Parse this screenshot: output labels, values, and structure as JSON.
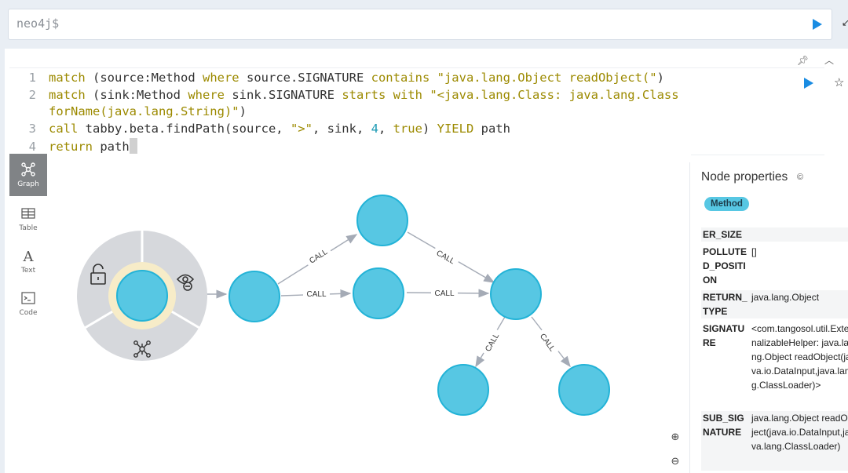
{
  "command_bar": {
    "prompt": "neo4j$"
  },
  "editor": {
    "lines": [
      {
        "n": "1",
        "parts": [
          {
            "c": "kw",
            "t": "match"
          },
          {
            "c": "txt",
            "t": " (source:Method "
          },
          {
            "c": "kw",
            "t": "where"
          },
          {
            "c": "txt",
            "t": " source.SIGNATURE "
          },
          {
            "c": "kw",
            "t": "contains"
          },
          {
            "c": "txt",
            "t": " "
          },
          {
            "c": "str",
            "t": "\"java.lang.Object readObject(\""
          },
          {
            "c": "txt",
            "t": ")"
          }
        ]
      },
      {
        "n": "2",
        "parts": [
          {
            "c": "kw",
            "t": "match"
          },
          {
            "c": "txt",
            "t": " (sink:Method "
          },
          {
            "c": "kw",
            "t": "where"
          },
          {
            "c": "txt",
            "t": " sink.SIGNATURE "
          },
          {
            "c": "kw",
            "t": "starts with"
          },
          {
            "c": "txt",
            "t": " "
          },
          {
            "c": "str",
            "t": "\"<java.lang.Class: java.lang.Class"
          }
        ]
      },
      {
        "n": "",
        "parts": [
          {
            "c": "str",
            "t": "forName(java.lang.String)\""
          },
          {
            "c": "txt",
            "t": ")"
          }
        ]
      },
      {
        "n": "3",
        "parts": [
          {
            "c": "kw",
            "t": "call"
          },
          {
            "c": "txt",
            "t": " tabby.beta.findPath(source, "
          },
          {
            "c": "str",
            "t": "\">\""
          },
          {
            "c": "txt",
            "t": ", sink, "
          },
          {
            "c": "num",
            "t": "4"
          },
          {
            "c": "txt",
            "t": ", "
          },
          {
            "c": "kw",
            "t": "true"
          },
          {
            "c": "txt",
            "t": ") "
          },
          {
            "c": "kw",
            "t": "YIELD"
          },
          {
            "c": "txt",
            "t": " path"
          }
        ]
      },
      {
        "n": "4",
        "parts": [
          {
            "c": "kw",
            "t": "return"
          },
          {
            "c": "txt",
            "t": " path"
          }
        ]
      }
    ]
  },
  "view_tabs": [
    {
      "label": "Graph",
      "active": true
    },
    {
      "label": "Table",
      "active": false
    },
    {
      "label": "Text",
      "active": false
    },
    {
      "label": "Code",
      "active": false
    }
  ],
  "graph": {
    "edge_label": "CALL",
    "node_color": "#57c7e3",
    "node_border": "#23b3d7"
  },
  "properties": {
    "title": "Node properties",
    "label_badge": "Method",
    "rows": [
      {
        "key": "ER_SIZE",
        "value": ""
      },
      {
        "key": "POLLUTED_POSITION",
        "value": "[]"
      },
      {
        "key": "RETURN_TYPE",
        "value": "java.lang.Object"
      },
      {
        "key": "SIGNATURE",
        "value": "<com.tangosol.util.ExternalizableHelper: java.lang.Object readObject(java.io.DataInput,java.lang.ClassLoader)>"
      },
      {
        "key": "SUB_SIGNATURE",
        "value": "java.lang.Object readObject(java.io.DataInput,java.lang.ClassLoader)"
      }
    ]
  }
}
